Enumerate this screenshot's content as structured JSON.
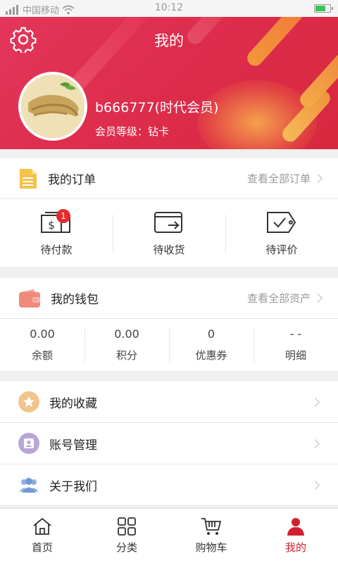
{
  "status_bar": {
    "carrier": "中国移动",
    "time": "10:12"
  },
  "header": {
    "title": "我的",
    "username": "b666777(时代会员)",
    "level": "会员等级：钻卡"
  },
  "orders": {
    "title": "我的订单",
    "more": "查看全部订单",
    "items": [
      {
        "label": "待付款",
        "icon": "wallet-dollar-icon",
        "badge": "1"
      },
      {
        "label": "待收货",
        "icon": "delivery-box-icon"
      },
      {
        "label": "待评价",
        "icon": "review-tag-icon"
      }
    ]
  },
  "wallet": {
    "title": "我的钱包",
    "more": "查看全部资产",
    "items": [
      {
        "value": "0.00",
        "label": "余额"
      },
      {
        "value": "0.00",
        "label": "积分"
      },
      {
        "value": "0",
        "label": "优惠券"
      },
      {
        "value": "- -",
        "label": "明细"
      }
    ]
  },
  "menu": [
    {
      "label": "我的收藏",
      "icon": "star-icon",
      "color": "#f2c48a"
    },
    {
      "label": "账号管理",
      "icon": "user-icon",
      "color": "#b9a6d6"
    },
    {
      "label": "关于我们",
      "icon": "group-icon",
      "color": "#8fb0e0"
    }
  ],
  "tabs": [
    {
      "label": "首页",
      "icon": "home-icon"
    },
    {
      "label": "分类",
      "icon": "grid-icon"
    },
    {
      "label": "购物车",
      "icon": "cart-icon"
    },
    {
      "label": "我的",
      "icon": "person-icon",
      "active": true
    }
  ],
  "colors": {
    "header": "#de2d4d",
    "accent": "#d0202e",
    "badge": "#e62a2a"
  }
}
